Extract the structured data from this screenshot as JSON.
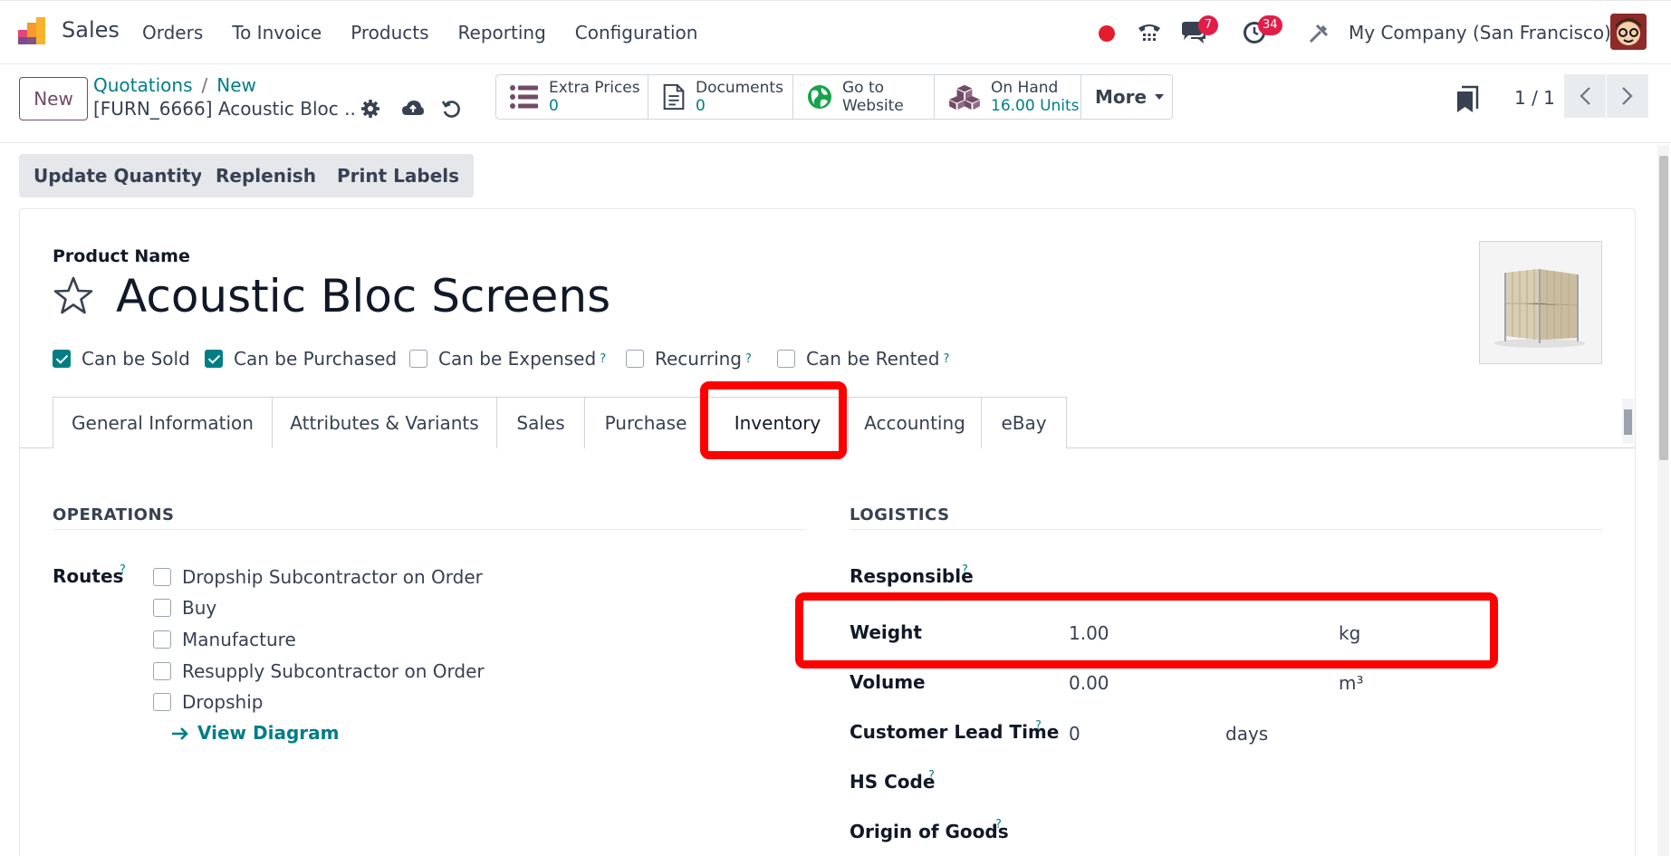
{
  "app": {
    "name": "Sales"
  },
  "menu": [
    "Orders",
    "To Invoice",
    "Products",
    "Reporting",
    "Configuration"
  ],
  "systray": {
    "messages_badge": "7",
    "activities_badge": "34",
    "company": "My Company (San Francisco)"
  },
  "control": {
    "new_label": "New",
    "breadcrumb": [
      "Quotations",
      "New"
    ],
    "record_name": "[FURN_6666] Acoustic Bloc ...",
    "stats": [
      {
        "label": "Extra Prices",
        "value": "0",
        "icon": "list-icon"
      },
      {
        "label": "Documents",
        "value": "0",
        "icon": "document-icon"
      },
      {
        "label": "Go to",
        "value": "Website",
        "icon": "globe-icon"
      },
      {
        "label": "On Hand",
        "value": "16.00 Units",
        "icon": "cubes-icon"
      }
    ],
    "more_label": "More",
    "pager": "1 / 1"
  },
  "actions": [
    "Update Quantity",
    "Replenish",
    "Print Labels"
  ],
  "product": {
    "name_label": "Product Name",
    "name": "Acoustic Bloc Screens",
    "flags": [
      {
        "label": "Can be Sold",
        "checked": true,
        "help": false
      },
      {
        "label": "Can be Purchased",
        "checked": true,
        "help": false
      },
      {
        "label": "Can be Expensed",
        "checked": false,
        "help": true
      },
      {
        "label": "Recurring",
        "checked": false,
        "help": true
      },
      {
        "label": "Can be Rented",
        "checked": false,
        "help": true
      }
    ]
  },
  "tabs": [
    "General Information",
    "Attributes & Variants",
    "Sales",
    "Purchase",
    "Inventory",
    "Accounting",
    "eBay"
  ],
  "operations": {
    "title": "OPERATIONS",
    "routes_label": "Routes",
    "routes": [
      "Dropship Subcontractor on Order",
      "Buy",
      "Manufacture",
      "Resupply Subcontractor on Order",
      "Dropship"
    ],
    "view_diagram": "View Diagram"
  },
  "logistics": {
    "title": "LOGISTICS",
    "responsible_label": "Responsible",
    "weight_label": "Weight",
    "weight_value": "1.00",
    "weight_unit": "kg",
    "volume_label": "Volume",
    "volume_value": "0.00",
    "volume_unit": "m³",
    "lead_label": "Customer Lead Time",
    "lead_value": "0",
    "lead_unit": "days",
    "hs_label": "HS Code",
    "origin_label": "Origin of Goods"
  },
  "colors": {
    "accent": "#017e84",
    "brand": "#714b67",
    "highlight": "#ff0000"
  }
}
